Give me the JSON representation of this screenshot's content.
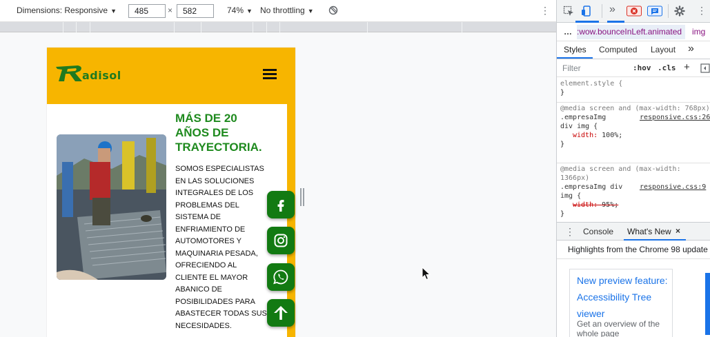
{
  "device_toolbar": {
    "dimensions_label": "Dimensions: Responsive",
    "width": "485",
    "height": "582",
    "times": "×",
    "zoom": "74%",
    "throttle": "No throttling",
    "more": "⋮"
  },
  "site": {
    "logo_text": "adisol",
    "title": "MÁS DE 20 AÑOS DE TRAYECTORIA.",
    "body": "SOMOS ESPECIALISTAS EN LAS SOLUCIONES INTEGRALES DE LOS PROBLEMAS DEL SISTEMA DE ENFRIAMIENTO DE AUTOMOTORES Y MAQUINARIA PESADA, OFRECIENDO AL CLIENTE EL MAYOR ABANICO DE POSIBILIDADES PARA ABASTECER TODAS SUS NECESIDADES.",
    "brand_green": "#127a12",
    "brand_yellow": "#f7b500",
    "fabs": [
      "facebook-icon",
      "instagram-icon",
      "whatsapp-icon",
      "arrow-up-icon"
    ]
  },
  "devtools": {
    "breadcrumb": {
      "dots": "…",
      "selected": ":wow.bounceInLeft.animated",
      "next": "img"
    },
    "tabs": [
      "Styles",
      "Computed",
      "Layout",
      "»"
    ],
    "filter": {
      "placeholder": "Filter",
      "hov": ":hov",
      "cls": ".cls",
      "plus": "+"
    },
    "rules": {
      "element_style": "element.style {",
      "close": "}",
      "r1": {
        "media": "@media screen and (max-width: 768px)",
        "selector": ".empresaImg",
        "link": "responsive.css:26",
        "selector2": "div img {",
        "prop": "width",
        "val": "100%;"
      },
      "r2": {
        "media": "@media screen and (max-width: 1366px)",
        "selector": ".empresaImg div",
        "link": "responsive.css:9",
        "selector2": "img {",
        "prop": "width",
        "val": "95%;"
      }
    },
    "drawer": {
      "console": "Console",
      "whats_new": "What's New",
      "close": "×"
    },
    "highlights": "Highlights from the Chrome 98 update",
    "whatsnew": {
      "link": "New preview feature: Accessibility Tree viewer",
      "desc": "Get an overview of the whole page"
    }
  }
}
